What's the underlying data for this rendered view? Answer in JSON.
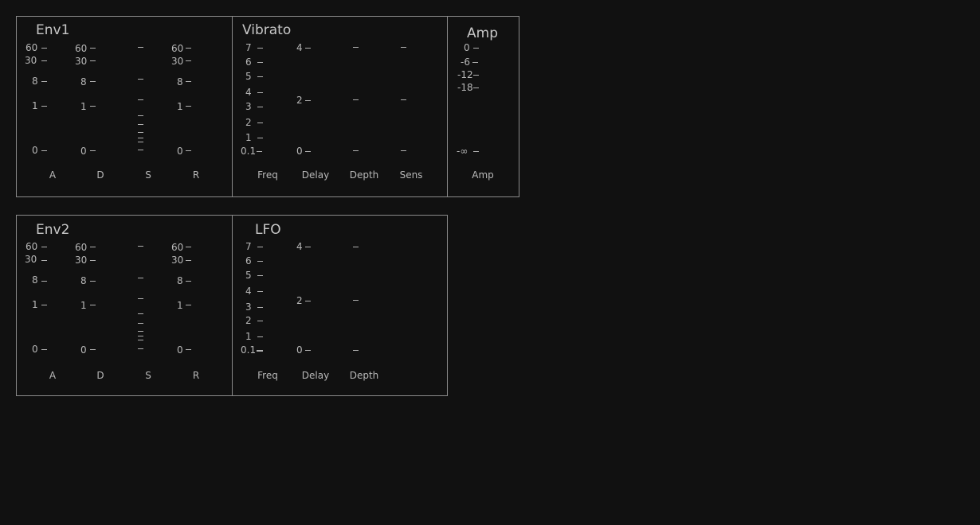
{
  "panels": {
    "env1": {
      "title": "Env1",
      "a_ticks": [
        "60",
        "30",
        "8",
        "1",
        "0"
      ],
      "d_ticks": [
        "60",
        "30",
        "8",
        "1",
        "0"
      ],
      "r_ticks": [
        "60",
        "30",
        "8",
        "1",
        "0"
      ],
      "labels": [
        "A",
        "D",
        "S",
        "R"
      ]
    },
    "vibrato": {
      "title": "Vibrato",
      "freq_ticks": [
        "7",
        "6",
        "5",
        "4",
        "3",
        "2",
        "1",
        "0.1"
      ],
      "delay_ticks": [
        "4",
        "2",
        "0"
      ],
      "labels": [
        "Freq",
        "Delay",
        "Depth",
        "Sens"
      ]
    },
    "amp": {
      "title": "Amp",
      "ticks": [
        "0",
        "-6",
        "-12",
        "-18",
        "-∞"
      ],
      "labels": [
        "Amp"
      ]
    },
    "env2": {
      "title": "Env2",
      "a_ticks": [
        "60",
        "30",
        "8",
        "1",
        "0"
      ],
      "d_ticks": [
        "60",
        "30",
        "8",
        "1",
        "0"
      ],
      "r_ticks": [
        "60",
        "30",
        "8",
        "1",
        "0"
      ],
      "labels": [
        "A",
        "D",
        "S",
        "R"
      ]
    },
    "lfo": {
      "title": "LFO",
      "freq_ticks": [
        "7",
        "6",
        "5",
        "4",
        "3",
        "2",
        "1",
        "0.1"
      ],
      "delay_ticks": [
        "4",
        "2",
        "0"
      ],
      "labels": [
        "Freq",
        "Delay",
        "Depth"
      ]
    }
  },
  "colors": {
    "background": "#111111",
    "border": "#8a8a8a",
    "text": "#b8b8b8"
  }
}
